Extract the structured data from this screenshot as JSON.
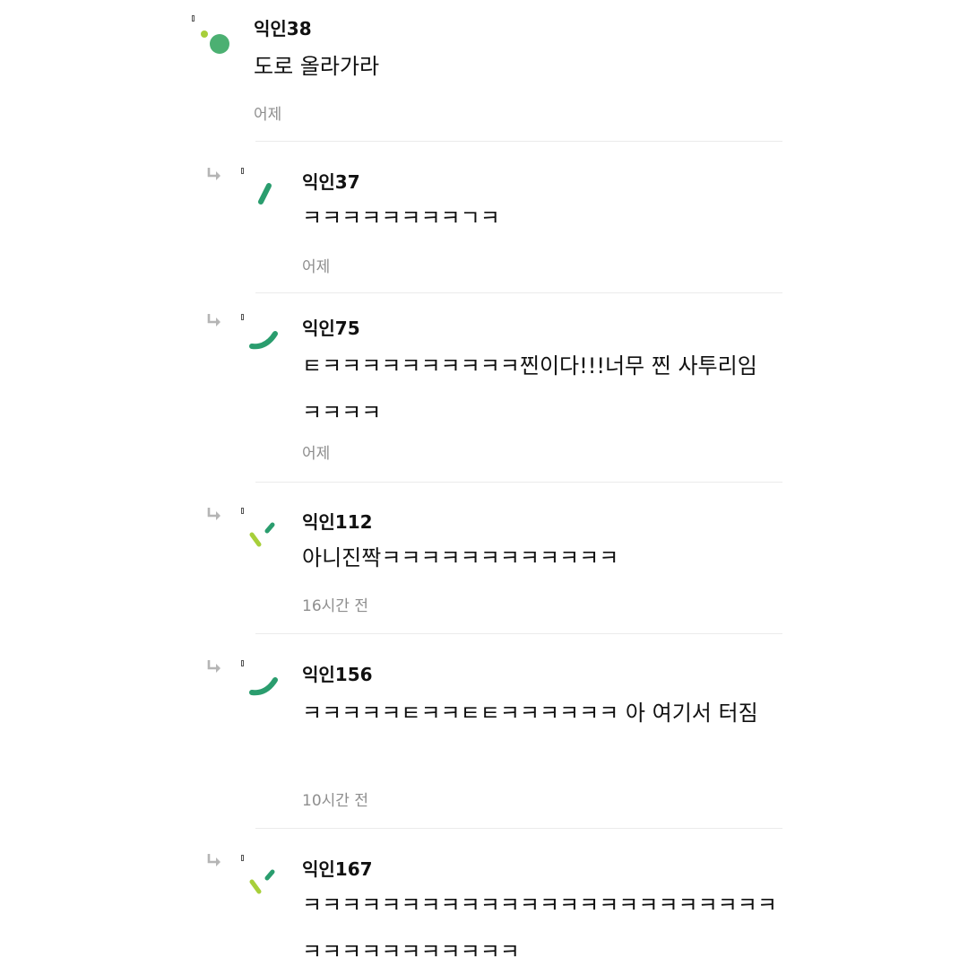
{
  "comments": [
    {
      "nickname": "익인38",
      "text": "도로 올라가라",
      "time": "어제"
    },
    {
      "nickname": "익인37",
      "text": "ㅋㅋㅋㅋㅋㅋㅋㅋㄱㅋ",
      "time": "어제"
    },
    {
      "nickname": "익인75",
      "text": "ㅌㅋㅋㅋㅋㅋㅋㅋㅋㅋㅋ찐이다!!!너무 찐 사투리임 ㅋㅋㅋㅋ",
      "time": "어제"
    },
    {
      "nickname": "익인112",
      "text": "아니진짝ㅋㅋㅋㅋㅋㅋㅋㅋㅋㅋㅋㅋ",
      "time": "16시간 전"
    },
    {
      "nickname": "익인156",
      "text": "ㅋㅋㅋㅋㅋㅌㅋㅋㅌㅌㅋㅋㅋㅋㅋㅋ 아 여기서 터짐",
      "time": "10시간 전"
    },
    {
      "nickname": "익인167",
      "text": "ㅋㅋㅋㅋㅋㅋㅋㅋㅋㅋㅋㅋㅋㅋㅋㅋㅋㅋㅋㅋㅋㅋㅋㅋㅋㅋㅋㅋㅋㅋㅋㅋㅋㅋㅋ",
      "time": ""
    }
  ],
  "icons": {
    "reply": "reply-arrow-icon",
    "avatar_main": "dots-avatar-icon",
    "avatar_reply": "stroke-avatar-icon"
  },
  "colors": {
    "avatar_green": "#3aa86b",
    "avatar_lime": "#a7cf3a",
    "avatar_teal": "#2a9d6e",
    "time_gray": "#8e8e8e"
  }
}
